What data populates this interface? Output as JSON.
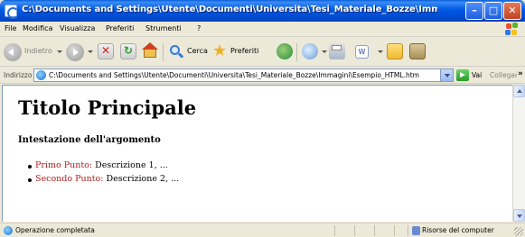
{
  "window": {
    "title": "C:\\Documents and Settings\\Utente\\Documenti\\Universita\\Tesi_Materiale_Bozze\\Immagini\\Esempio_HTM ...",
    "min_icon": "minimize-icon",
    "max_icon": "maximize-icon",
    "close_icon": "close-icon"
  },
  "menu": {
    "items": [
      "File",
      "Modifica",
      "Visualizza",
      "Preferiti",
      "Strumenti",
      "?"
    ]
  },
  "toolbar": {
    "back_label": "Indietro",
    "search_label": "Cerca",
    "favorites_label": "Preferiti"
  },
  "address": {
    "label": "Indirizzo",
    "value": "C:\\Documents and Settings\\Utente\\Documenti\\Universita\\Tesi_Materiale_Bozze\\Immagini\\Esempio_HTML.htm",
    "go_label": "Vai",
    "links_label": "Collegamenti",
    "more": "»"
  },
  "page": {
    "heading": "Titolo Principale",
    "subheading": "Intestazione dell'argomento",
    "items": [
      {
        "term": "Primo Punto:",
        "desc": " Descrizione 1, ..."
      },
      {
        "term": "Secondo Punto:",
        "desc": " Descrizione 2, ..."
      }
    ]
  },
  "status": {
    "text": "Operazione completata",
    "zone": "Risorse del computer"
  },
  "colors": {
    "titlebar": "#0058e6",
    "term": "#b02020"
  }
}
